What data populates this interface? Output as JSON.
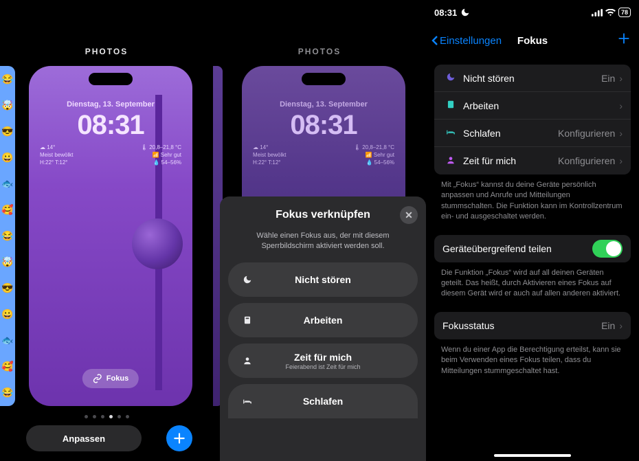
{
  "left": {
    "category_label": "PHOTOS",
    "date": "Dienstag, 13. September",
    "time": "08:31",
    "weather_widget": {
      "temp": "14°",
      "cond": "Meist bewölkt",
      "hl": "H:22° T:12°"
    },
    "air_widget": {
      "range": "20,8–21,8 °C",
      "quality": "Sehr gut",
      "humidity": "54–56%"
    },
    "focus_chip": "Fokus",
    "active_dot_index": 3,
    "customize_button": "Anpassen",
    "emoji_strip": [
      "😂",
      "🤯",
      "😎",
      "😀",
      "🐟",
      "🥰",
      "😂",
      "🤯",
      "😎",
      "😀",
      "🐟",
      "🥰",
      "😂"
    ]
  },
  "mid": {
    "category_label": "PHOTOS",
    "date": "Dienstag, 13. September",
    "time": "08:31",
    "weather_widget": {
      "temp": "14°",
      "cond": "Meist bewölkt",
      "hl": "H:22° T:12°"
    },
    "air_widget": {
      "range": "20,8–21,8 °C",
      "quality": "Sehr gut",
      "humidity": "54–56%"
    },
    "sheet": {
      "title": "Fokus verknüpfen",
      "subtitle": "Wähle einen Fokus aus, der mit diesem Sperrbildschirm aktiviert werden soll.",
      "options": [
        {
          "label": "Nicht stören",
          "subtitle": ""
        },
        {
          "label": "Arbeiten",
          "subtitle": ""
        },
        {
          "label": "Zeit für mich",
          "subtitle": "Feierabend ist Zeit für mich"
        },
        {
          "label": "Schlafen",
          "subtitle": ""
        }
      ]
    }
  },
  "right": {
    "status": {
      "time": "08:31",
      "battery": "78"
    },
    "nav": {
      "back": "Einstellungen",
      "title": "Fokus"
    },
    "modes": [
      {
        "icon_color": "#6e5dd9",
        "label": "Nicht stören",
        "value": "Ein"
      },
      {
        "icon_color": "#32d0c3",
        "label": "Arbeiten",
        "value": ""
      },
      {
        "icon_color": "#34c9c1",
        "label": "Schlafen",
        "value": "Konfigurieren"
      },
      {
        "icon_color": "#bf5af2",
        "label": "Zeit für mich",
        "value": "Konfigurieren"
      }
    ],
    "modes_footer": "Mit „Fokus“ kannst du deine Geräte persönlich anpassen und Anrufe und Mitteilungen stummschalten. Die Funktion kann im Kontrollzentrum ein- und ausgeschaltet werden.",
    "share": {
      "label": "Geräteübergreifend teilen",
      "on": true
    },
    "share_footer": "Die Funktion „Fokus“ wird auf all deinen Geräten geteilt. Das heißt, durch Aktivieren eines Fokus auf diesem Gerät wird er auch auf allen anderen aktiviert.",
    "status_row": {
      "label": "Fokusstatus",
      "value": "Ein"
    },
    "status_footer": "Wenn du einer App die Berechtigung erteilst, kann sie beim Verwenden eines Fokus teilen, dass du Mitteilungen stummgeschaltet hast."
  }
}
